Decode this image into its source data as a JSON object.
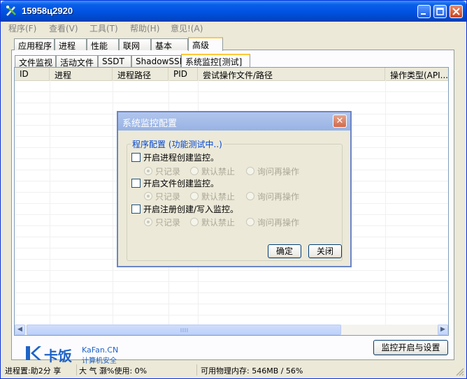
{
  "window": {
    "title": "15958ц2920"
  },
  "menu": [
    "程序(F)",
    "查看(V)",
    "工具(T)",
    "帮助(H)",
    "意见!(A)"
  ],
  "main_tabs": [
    "应用程序",
    "进程",
    "性能",
    "联网",
    "基本",
    "高级"
  ],
  "sub_tabs": [
    "文件监视",
    "活动文件",
    "SSDT",
    "ShadowSSDT",
    "系统监控[测试]"
  ],
  "columns": [
    "ID",
    "进程",
    "进程路径",
    "PID",
    "尝试操作文件/路径",
    "操作类型(API..."
  ],
  "dialog": {
    "title": "系统监控配置",
    "close_glyph": "✕",
    "group_label": "程序配置 (功能测试中..)",
    "sections": [
      {
        "label": "开启进程创建监控。",
        "options": [
          "只记录",
          "默认禁止",
          "询问再操作"
        ]
      },
      {
        "label": "开启文件创建监控。",
        "options": [
          "只记录",
          "默认禁止",
          "询问再操作"
        ]
      },
      {
        "label": "开启注册创建/写入监控。",
        "options": [
          "只记录",
          "默认禁止",
          "询问再操作"
        ]
      }
    ],
    "ok_label": "确定",
    "close_label": "关闭"
  },
  "monitor_button": "监控开启与设置",
  "logo": {
    "brand": "卡饭",
    "site": "KaFan.CN",
    "slogan": "计算机安全"
  },
  "status": {
    "left": "进程置:助2分 享",
    "middle": "大 气 灏%使用: 0%",
    "memory": "可用物理内存: 546MB / 56%"
  },
  "colors": {
    "titlebar": "#0054e3",
    "logo_blue": "#1e63c6",
    "link": "#0046d5"
  }
}
